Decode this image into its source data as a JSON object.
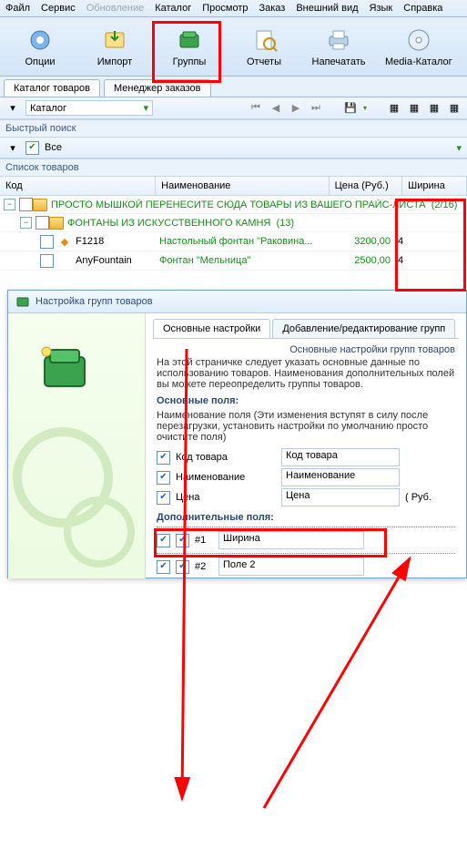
{
  "menu": {
    "items": [
      "Файл",
      "Сервис",
      "Обновление",
      "Каталог",
      "Просмотр",
      "Заказ",
      "Внешний вид",
      "Язык",
      "Справка"
    ],
    "disabled_index": 2
  },
  "toolbar": {
    "items": [
      {
        "label": "Опции",
        "icon": "gear-icon"
      },
      {
        "label": "Импорт",
        "icon": "import-icon"
      },
      {
        "label": "Группы",
        "icon": "groups-icon"
      },
      {
        "label": "Отчеты",
        "icon": "reports-icon"
      },
      {
        "label": "Напечатать",
        "icon": "print-icon"
      },
      {
        "label": "Media-Каталог",
        "icon": "media-icon"
      }
    ]
  },
  "tabs": {
    "items": [
      "Каталог товаров",
      "Менеджер заказов"
    ],
    "active": 0
  },
  "catalog_dd": {
    "label": "Каталог"
  },
  "quicksearch": {
    "title": "Быстрый поиск",
    "value": "Все"
  },
  "list": {
    "title": "Список товаров",
    "columns": {
      "code": "Код",
      "name": "Наименование",
      "price": "Цена (Руб.)",
      "width": "Ширина"
    },
    "root": {
      "label": "ПРОСТО МЫШКОЙ ПЕРЕНЕСИТЕ СЮДА ТОВАРЫ ИЗ ВАШЕГО ПРАЙС-ЛИСТА",
      "count": "(2/16)"
    },
    "group": {
      "label": "ФОНТАНЫ ИЗ ИСКУССТВЕННОГО КАМНЯ",
      "count": "(13)"
    },
    "rows": [
      {
        "code": "F1218",
        "name": "Настольный фонтан \"Раковина...",
        "price": "3200,00",
        "width": "4"
      },
      {
        "code": "AnyFountain",
        "name": "Фонтан \"Мельница\"",
        "price": "2500,00",
        "width": "4"
      }
    ]
  },
  "dlg": {
    "title": "Настройка групп товаров",
    "tabs": [
      "Основные настройки",
      "Добавление/редактирование групп"
    ],
    "heading": "Основные настройки групп товаров",
    "intro": "На этой страничке следует указать основные данные по использованию товаров. Наименования дополнительных полей вы можете переопределить группы товаров.",
    "main_fields": {
      "title": "Основные поля:",
      "hint": "Наименование поля (Эти изменения вступят в силу после перезагрузки, установить настройки по умолчанию просто очистите поля)",
      "rows": [
        {
          "label": "Код товара",
          "value": "Код товара"
        },
        {
          "label": "Наименование",
          "value": "Наименование"
        },
        {
          "label": "Цена",
          "value": "Цена",
          "suffix": "(    Руб."
        }
      ]
    },
    "extra_fields": {
      "title": "Дополнительные поля:",
      "rows": [
        {
          "num": "#1",
          "value": "Ширина"
        },
        {
          "num": "#2",
          "value": "Поле 2"
        }
      ]
    }
  }
}
